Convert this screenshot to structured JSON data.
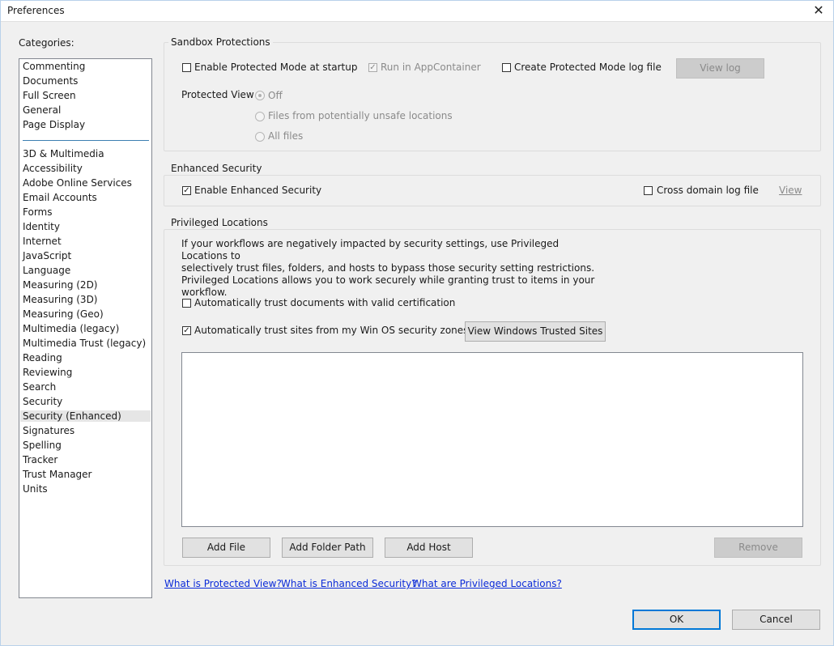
{
  "window": {
    "title": "Preferences",
    "close_glyph": "✕"
  },
  "categories": {
    "label": "Categories:",
    "group1": [
      "Commenting",
      "Documents",
      "Full Screen",
      "General",
      "Page Display"
    ],
    "group2": [
      "3D & Multimedia",
      "Accessibility",
      "Adobe Online Services",
      "Email Accounts",
      "Forms",
      "Identity",
      "Internet",
      "JavaScript",
      "Language",
      "Measuring (2D)",
      "Measuring (3D)",
      "Measuring (Geo)",
      "Multimedia (legacy)",
      "Multimedia Trust (legacy)",
      "Reading",
      "Reviewing",
      "Search",
      "Security",
      "Security (Enhanced)",
      "Signatures",
      "Spelling",
      "Tracker",
      "Trust Manager",
      "Units"
    ],
    "selected": "Security (Enhanced)"
  },
  "sandbox": {
    "title": "Sandbox Protections",
    "protected_mode_label": "Enable Protected Mode at startup",
    "protected_mode_checked": false,
    "appcontainer_label": "Run in AppContainer",
    "appcontainer_checked": true,
    "log_file_label": "Create Protected Mode log file",
    "log_file_checked": false,
    "view_log_button": "View log",
    "protected_view_label": "Protected View",
    "protected_view_options": [
      "Off",
      "Files from potentially unsafe locations",
      "All files"
    ],
    "protected_view_selected": "Off"
  },
  "enhanced": {
    "title": "Enhanced Security",
    "enable_label": "Enable Enhanced Security",
    "enable_checked": true,
    "cross_domain_label": "Cross domain log file",
    "cross_domain_checked": false,
    "view_link": "View"
  },
  "privileged": {
    "title": "Privileged Locations",
    "description_lines": [
      "If your workflows are negatively impacted by security settings, use Privileged Locations to",
      "selectively trust files, folders, and hosts to bypass those security setting restrictions.",
      "Privileged Locations allows you to work securely while granting trust to items in your",
      "workflow."
    ],
    "trust_cert_label": "Automatically trust documents with valid certification",
    "trust_cert_checked": false,
    "trust_sites_label": "Automatically trust sites from my Win OS security zones",
    "trust_sites_checked": true,
    "view_trusted_button": "View Windows Trusted Sites",
    "add_file_button": "Add File",
    "add_folder_button": "Add Folder Path",
    "add_host_button": "Add Host",
    "remove_button": "Remove",
    "locations": []
  },
  "help_links": [
    "What is Protected View?",
    "What is Enhanced Security?",
    "What are Privileged Locations?"
  ],
  "footer": {
    "ok_button": "OK",
    "cancel_button": "Cancel"
  },
  "colors": {
    "link": "#0b2bd8",
    "accent": "#0078d7",
    "selected_row": "#e6e6e6",
    "divider": "#3c7fb1"
  }
}
